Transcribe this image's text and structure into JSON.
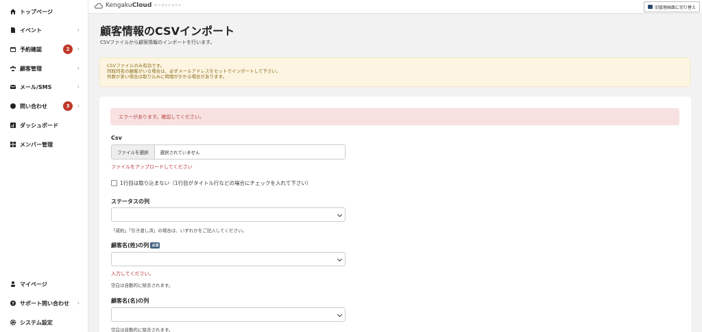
{
  "sidebar": {
    "items": [
      {
        "label": "トップページ",
        "icon": "home-icon"
      },
      {
        "label": "イベント",
        "icon": "document-icon"
      },
      {
        "label": "予約確認",
        "icon": "calendar-icon",
        "badge": "2"
      },
      {
        "label": "顧客管理",
        "icon": "users-icon"
      },
      {
        "label": "メール/SMS",
        "icon": "mail-icon"
      },
      {
        "label": "問い合わせ",
        "icon": "chat-icon",
        "badge": "3"
      },
      {
        "label": "ダッシュボード",
        "icon": "chart-icon"
      },
      {
        "label": "メンバー管理",
        "icon": "grid-icon"
      }
    ],
    "bottom_items": [
      {
        "label": "マイページ",
        "icon": "person-icon"
      },
      {
        "label": "サポート問い合わせ",
        "icon": "help-icon"
      },
      {
        "label": "システム設定",
        "icon": "gear-icon"
      }
    ]
  },
  "topbar": {
    "logo_light": "Kengaku",
    "logo_bold": "Cloud",
    "logo_sub": "ケンガククラウド",
    "switch_label": "旧管理画面に切り替え"
  },
  "page": {
    "title": "顧客情報のCSVインポート",
    "description": "CSVファイルから顧客情報のインポートを行います。"
  },
  "notice": {
    "lines": [
      "CSVファイルのみ有効です。",
      "同姓同名の顧客がいる場合は、必ずメールアドレスをセットでインポートして下さい。",
      "件数が多い場合は取り込みに時間がかかる場合があります。"
    ]
  },
  "form": {
    "error_banner": "エラーがあります。確認してください。",
    "csv_label": "Csv",
    "file_button": "ファイルを選択",
    "file_status": "選択されていません",
    "file_error": "ファイルをアップロードしてください",
    "skip_first_row": "1行目は取り込まない（1行目がタイトル行などの場合にチェックを入れて下さい）",
    "status_label": "ステータスの列",
    "status_help": "「成約」「引き渡し済」の場合は、いずれかをご記入してください。",
    "last_name_label": "顧客名(姓)の列",
    "required_badge": "必須",
    "last_name_error": "入力してください。",
    "last_name_help": "空白は自動的に除去されます。",
    "first_name_label": "顧客名(名)の列",
    "first_name_help": "空白は自動的に除去されます。"
  },
  "colors": {
    "badge": "#c0392b",
    "error": "#b33333",
    "warning_bg": "#fdf5e1",
    "error_bg": "#f8e1e1",
    "accent": "#3b5a7a"
  }
}
